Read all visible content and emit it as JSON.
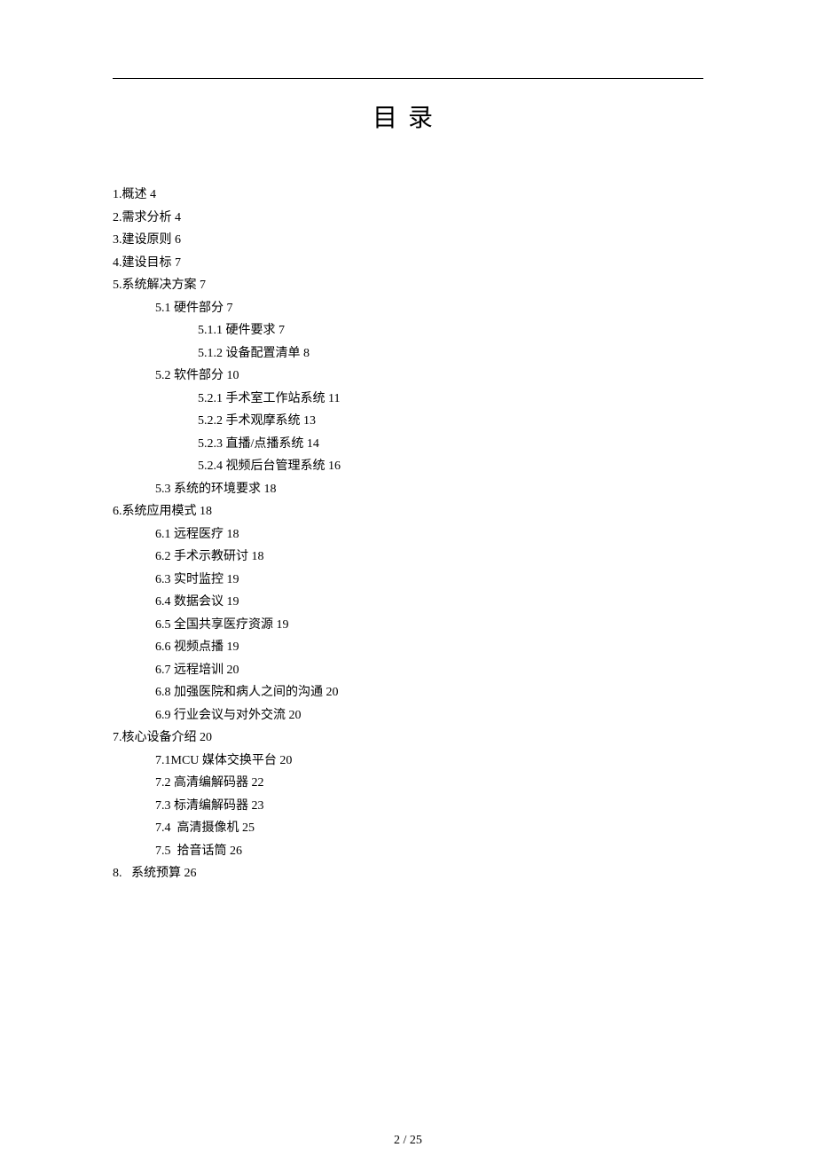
{
  "title": "目录",
  "pageNumber": "2 / 25",
  "toc": [
    {
      "level": 1,
      "text": "1.概述 4"
    },
    {
      "level": 1,
      "text": "2.需求分析 4"
    },
    {
      "level": 1,
      "text": "3.建设原则 6"
    },
    {
      "level": 1,
      "text": "4.建设目标 7"
    },
    {
      "level": 1,
      "text": "5.系统解决方案 7"
    },
    {
      "level": 2,
      "text": "5.1 硬件部分 7"
    },
    {
      "level": 3,
      "text": "5.1.1 硬件要求 7"
    },
    {
      "level": 3,
      "text": "5.1.2 设备配置清单 8"
    },
    {
      "level": 2,
      "text": "5.2 软件部分 10"
    },
    {
      "level": 3,
      "text": "5.2.1 手术室工作站系统 11"
    },
    {
      "level": 3,
      "text": "5.2.2 手术观摩系统 13"
    },
    {
      "level": 3,
      "text": "5.2.3 直播/点播系统 14"
    },
    {
      "level": 3,
      "text": "5.2.4 视频后台管理系统 16"
    },
    {
      "level": 2,
      "text": "5.3 系统的环境要求 18"
    },
    {
      "level": 1,
      "text": "6.系统应用模式 18"
    },
    {
      "level": 2,
      "text": "6.1 远程医疗 18"
    },
    {
      "level": 2,
      "text": "6.2 手术示教研讨 18"
    },
    {
      "level": 2,
      "text": "6.3 实时监控 19"
    },
    {
      "level": 2,
      "text": "6.4 数据会议 19"
    },
    {
      "level": 2,
      "text": "6.5 全国共享医疗资源 19"
    },
    {
      "level": 2,
      "text": "6.6 视频点播 19"
    },
    {
      "level": 2,
      "text": "6.7 远程培训 20"
    },
    {
      "level": 2,
      "text": "6.8 加强医院和病人之间的沟通 20"
    },
    {
      "level": 2,
      "text": "6.9 行业会议与对外交流 20"
    },
    {
      "level": 1,
      "text": "7.核心设备介绍 20"
    },
    {
      "level": 2,
      "text": "7.1MCU 媒体交换平台 20"
    },
    {
      "level": 2,
      "text": "7.2 高清编解码器 22"
    },
    {
      "level": 2,
      "text": "7.3 标清编解码器 23"
    },
    {
      "level": 2,
      "text": "7.4  高清摄像机 25"
    },
    {
      "level": 2,
      "text": "7.5  拾音话筒 26"
    },
    {
      "level": 1,
      "text": "8.   系统预算 26"
    }
  ]
}
